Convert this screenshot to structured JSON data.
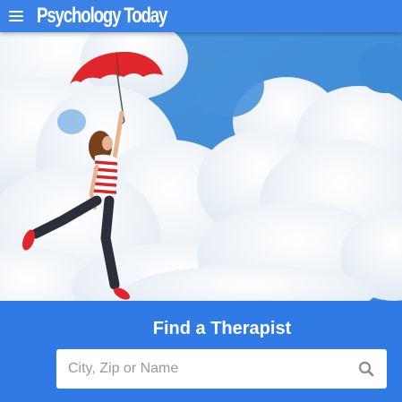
{
  "header": {
    "menu_icon": "hamburger-menu-icon",
    "logo_text": "Psychology Today"
  },
  "hero": {
    "image_subject": ""
  },
  "find_therapist": {
    "title": "Find a Therapist",
    "search": {
      "placeholder": "City, Zip or Name",
      "value": "",
      "icon": "search-icon"
    }
  },
  "colors": {
    "header_bg": "#3b82e6",
    "panel_bg": "#2f7ae5",
    "sky": "#3f8fd8",
    "umbrella": "#e0262b"
  }
}
